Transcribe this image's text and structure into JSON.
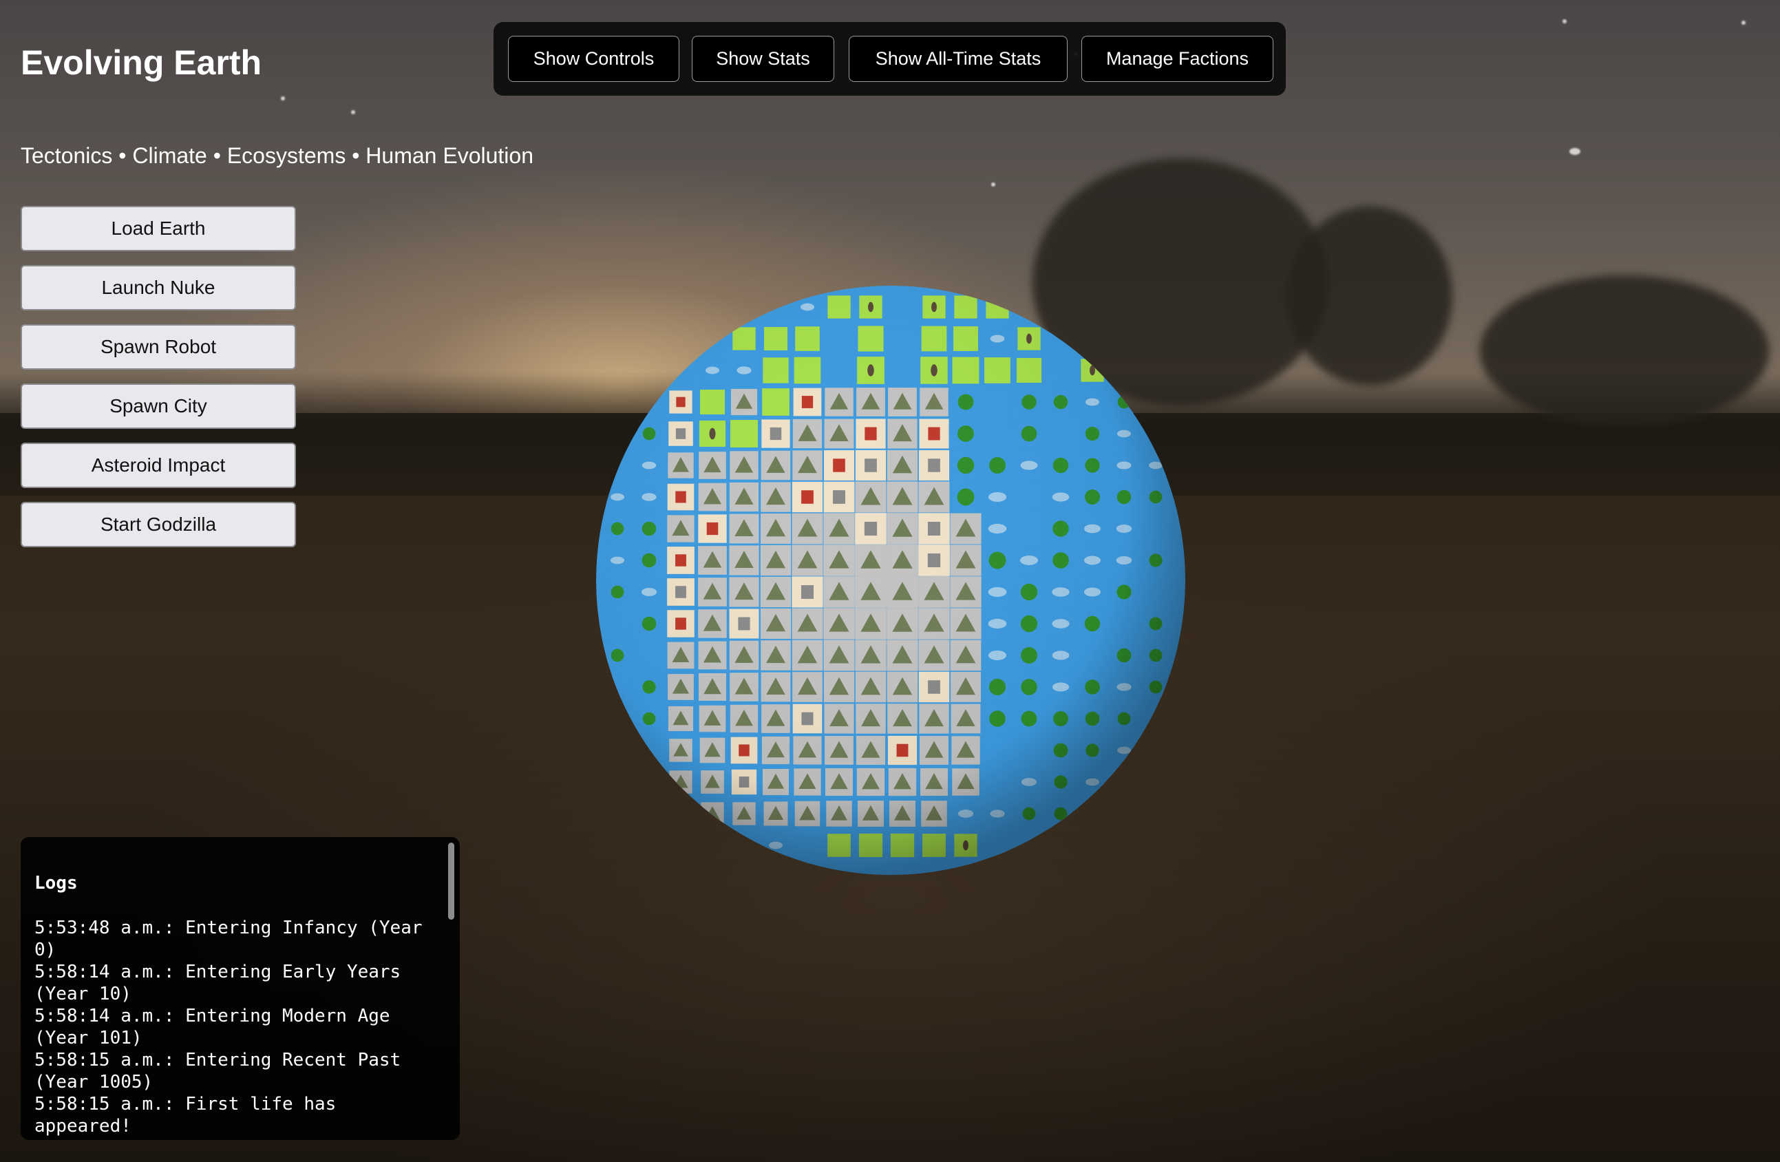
{
  "app": {
    "title": "Evolving Earth",
    "subtitle": "Tectonics • Climate • Ecosystems • Human Evolution"
  },
  "toolbar": {
    "show_controls": "Show Controls",
    "show_stats": "Show Stats",
    "show_all_time_stats": "Show All-Time Stats",
    "manage_factions": "Manage Factions"
  },
  "actions": {
    "load_earth": "Load Earth",
    "launch_nuke": "Launch Nuke",
    "spawn_robot": "Spawn Robot",
    "spawn_city": "Spawn City",
    "asteroid_impact": "Asteroid Impact",
    "start_godzilla": "Start Godzilla"
  },
  "logs": {
    "title": "Logs",
    "entries": [
      "5:53:48 a.m.: Entering Infancy (Year 0)",
      "5:58:14 a.m.: Entering Early Years (Year 10)",
      "5:58:14 a.m.: Entering Modern Age (Year 101)",
      "5:58:15 a.m.: Entering Recent Past (Year 1005)",
      "5:58:15 a.m.: First life has appeared!"
    ]
  },
  "globe": {
    "tile_types": [
      "ocean",
      "fish-icon",
      "virus-icon",
      "dolphin-icon",
      "grassland",
      "footprints-icon",
      "mountain-icon",
      "desert-island-icon",
      "classical-building-icon",
      "castle-icon",
      "beach-flag-icon"
    ]
  },
  "colors": {
    "ocean": "#3d9be0",
    "grass": "#a8e14a",
    "mountain": "#c3c3c3",
    "desert": "#f0e2c8",
    "panel": "#000000",
    "button_light": "#e9e8ed"
  }
}
